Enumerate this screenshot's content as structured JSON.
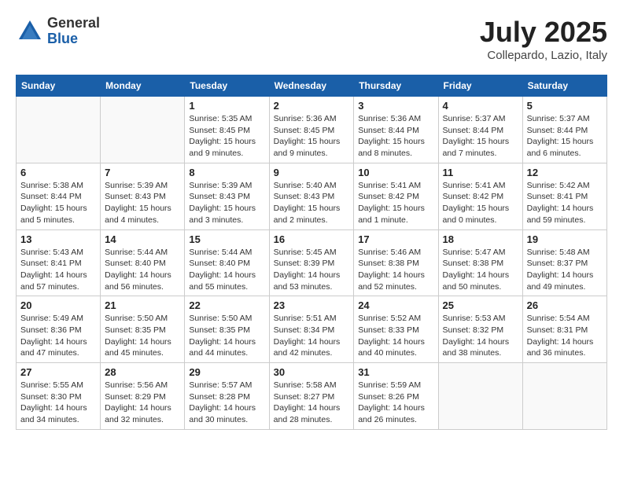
{
  "header": {
    "logo_general": "General",
    "logo_blue": "Blue",
    "month_title": "July 2025",
    "location": "Collepardo, Lazio, Italy"
  },
  "weekdays": [
    "Sunday",
    "Monday",
    "Tuesday",
    "Wednesday",
    "Thursday",
    "Friday",
    "Saturday"
  ],
  "weeks": [
    [
      {
        "day": "",
        "info": ""
      },
      {
        "day": "",
        "info": ""
      },
      {
        "day": "1",
        "info": "Sunrise: 5:35 AM\nSunset: 8:45 PM\nDaylight: 15 hours and 9 minutes."
      },
      {
        "day": "2",
        "info": "Sunrise: 5:36 AM\nSunset: 8:45 PM\nDaylight: 15 hours and 9 minutes."
      },
      {
        "day": "3",
        "info": "Sunrise: 5:36 AM\nSunset: 8:44 PM\nDaylight: 15 hours and 8 minutes."
      },
      {
        "day": "4",
        "info": "Sunrise: 5:37 AM\nSunset: 8:44 PM\nDaylight: 15 hours and 7 minutes."
      },
      {
        "day": "5",
        "info": "Sunrise: 5:37 AM\nSunset: 8:44 PM\nDaylight: 15 hours and 6 minutes."
      }
    ],
    [
      {
        "day": "6",
        "info": "Sunrise: 5:38 AM\nSunset: 8:44 PM\nDaylight: 15 hours and 5 minutes."
      },
      {
        "day": "7",
        "info": "Sunrise: 5:39 AM\nSunset: 8:43 PM\nDaylight: 15 hours and 4 minutes."
      },
      {
        "day": "8",
        "info": "Sunrise: 5:39 AM\nSunset: 8:43 PM\nDaylight: 15 hours and 3 minutes."
      },
      {
        "day": "9",
        "info": "Sunrise: 5:40 AM\nSunset: 8:43 PM\nDaylight: 15 hours and 2 minutes."
      },
      {
        "day": "10",
        "info": "Sunrise: 5:41 AM\nSunset: 8:42 PM\nDaylight: 15 hours and 1 minute."
      },
      {
        "day": "11",
        "info": "Sunrise: 5:41 AM\nSunset: 8:42 PM\nDaylight: 15 hours and 0 minutes."
      },
      {
        "day": "12",
        "info": "Sunrise: 5:42 AM\nSunset: 8:41 PM\nDaylight: 14 hours and 59 minutes."
      }
    ],
    [
      {
        "day": "13",
        "info": "Sunrise: 5:43 AM\nSunset: 8:41 PM\nDaylight: 14 hours and 57 minutes."
      },
      {
        "day": "14",
        "info": "Sunrise: 5:44 AM\nSunset: 8:40 PM\nDaylight: 14 hours and 56 minutes."
      },
      {
        "day": "15",
        "info": "Sunrise: 5:44 AM\nSunset: 8:40 PM\nDaylight: 14 hours and 55 minutes."
      },
      {
        "day": "16",
        "info": "Sunrise: 5:45 AM\nSunset: 8:39 PM\nDaylight: 14 hours and 53 minutes."
      },
      {
        "day": "17",
        "info": "Sunrise: 5:46 AM\nSunset: 8:38 PM\nDaylight: 14 hours and 52 minutes."
      },
      {
        "day": "18",
        "info": "Sunrise: 5:47 AM\nSunset: 8:38 PM\nDaylight: 14 hours and 50 minutes."
      },
      {
        "day": "19",
        "info": "Sunrise: 5:48 AM\nSunset: 8:37 PM\nDaylight: 14 hours and 49 minutes."
      }
    ],
    [
      {
        "day": "20",
        "info": "Sunrise: 5:49 AM\nSunset: 8:36 PM\nDaylight: 14 hours and 47 minutes."
      },
      {
        "day": "21",
        "info": "Sunrise: 5:50 AM\nSunset: 8:35 PM\nDaylight: 14 hours and 45 minutes."
      },
      {
        "day": "22",
        "info": "Sunrise: 5:50 AM\nSunset: 8:35 PM\nDaylight: 14 hours and 44 minutes."
      },
      {
        "day": "23",
        "info": "Sunrise: 5:51 AM\nSunset: 8:34 PM\nDaylight: 14 hours and 42 minutes."
      },
      {
        "day": "24",
        "info": "Sunrise: 5:52 AM\nSunset: 8:33 PM\nDaylight: 14 hours and 40 minutes."
      },
      {
        "day": "25",
        "info": "Sunrise: 5:53 AM\nSunset: 8:32 PM\nDaylight: 14 hours and 38 minutes."
      },
      {
        "day": "26",
        "info": "Sunrise: 5:54 AM\nSunset: 8:31 PM\nDaylight: 14 hours and 36 minutes."
      }
    ],
    [
      {
        "day": "27",
        "info": "Sunrise: 5:55 AM\nSunset: 8:30 PM\nDaylight: 14 hours and 34 minutes."
      },
      {
        "day": "28",
        "info": "Sunrise: 5:56 AM\nSunset: 8:29 PM\nDaylight: 14 hours and 32 minutes."
      },
      {
        "day": "29",
        "info": "Sunrise: 5:57 AM\nSunset: 8:28 PM\nDaylight: 14 hours and 30 minutes."
      },
      {
        "day": "30",
        "info": "Sunrise: 5:58 AM\nSunset: 8:27 PM\nDaylight: 14 hours and 28 minutes."
      },
      {
        "day": "31",
        "info": "Sunrise: 5:59 AM\nSunset: 8:26 PM\nDaylight: 14 hours and 26 minutes."
      },
      {
        "day": "",
        "info": ""
      },
      {
        "day": "",
        "info": ""
      }
    ]
  ]
}
